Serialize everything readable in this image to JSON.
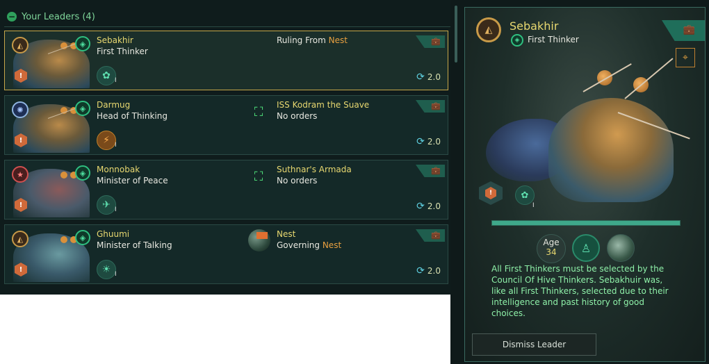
{
  "header": {
    "toggle_icon": "−",
    "title": "Your Leaders (4)"
  },
  "leaders": [
    {
      "name": "Sebakhir",
      "role": "First Thinker",
      "location_label": "Ruling From ",
      "location_highlight": "Nest",
      "location_sub": "",
      "location_sub_highlight": "",
      "upkeep": "2.0",
      "trait_level": "I",
      "emblem": "gold-emblem",
      "trait_icon": "brain-icon",
      "location_icon": ""
    },
    {
      "name": "Darmug",
      "role": "Head of Thinking",
      "location_label": "ISS Kodram the Suave",
      "location_highlight": "",
      "location_sub": "No orders",
      "location_sub_highlight": "",
      "upkeep": "2.0",
      "trait_level": "I",
      "emblem": "blue-emblem",
      "trait_icon": "orange-trait-icon",
      "location_icon": "fleet-icon"
    },
    {
      "name": "Monnobak",
      "role": "Minister of Peace",
      "location_label": "Suthnar's Armada",
      "location_highlight": "",
      "location_sub": "No orders",
      "location_sub_highlight": "",
      "upkeep": "2.0",
      "trait_level": "I",
      "emblem": "red-emblem",
      "trait_icon": "dove-icon",
      "location_icon": "fleet-icon"
    },
    {
      "name": "Ghuumi",
      "role": "Minister of Talking",
      "location_label": "Nest",
      "location_highlight": "",
      "location_sub": "Governing ",
      "location_sub_highlight": "Nest",
      "upkeep": "2.0",
      "trait_level": "I",
      "emblem": "gold-emblem",
      "trait_icon": "lightbulb-icon",
      "location_icon": "planet-icon"
    }
  ],
  "detail": {
    "name": "Sebakhir",
    "role": "First Thinker",
    "age_label": "Age",
    "age_value": "34",
    "trait_level": "I",
    "bio": "All First Thinkers must be selected by the Council Of Hive Thinkers.  Sebakhuir was, like all First Thinkers, selected due to their intelligence and past history of good choices.",
    "dismiss_label": "Dismiss Leader",
    "xp_progress": 1.0
  },
  "colors": {
    "accent_gold": "#e8d870",
    "accent_green": "#8ef0a8",
    "highlight_orange": "#e8a040",
    "selected_border": "#c8a84a"
  }
}
